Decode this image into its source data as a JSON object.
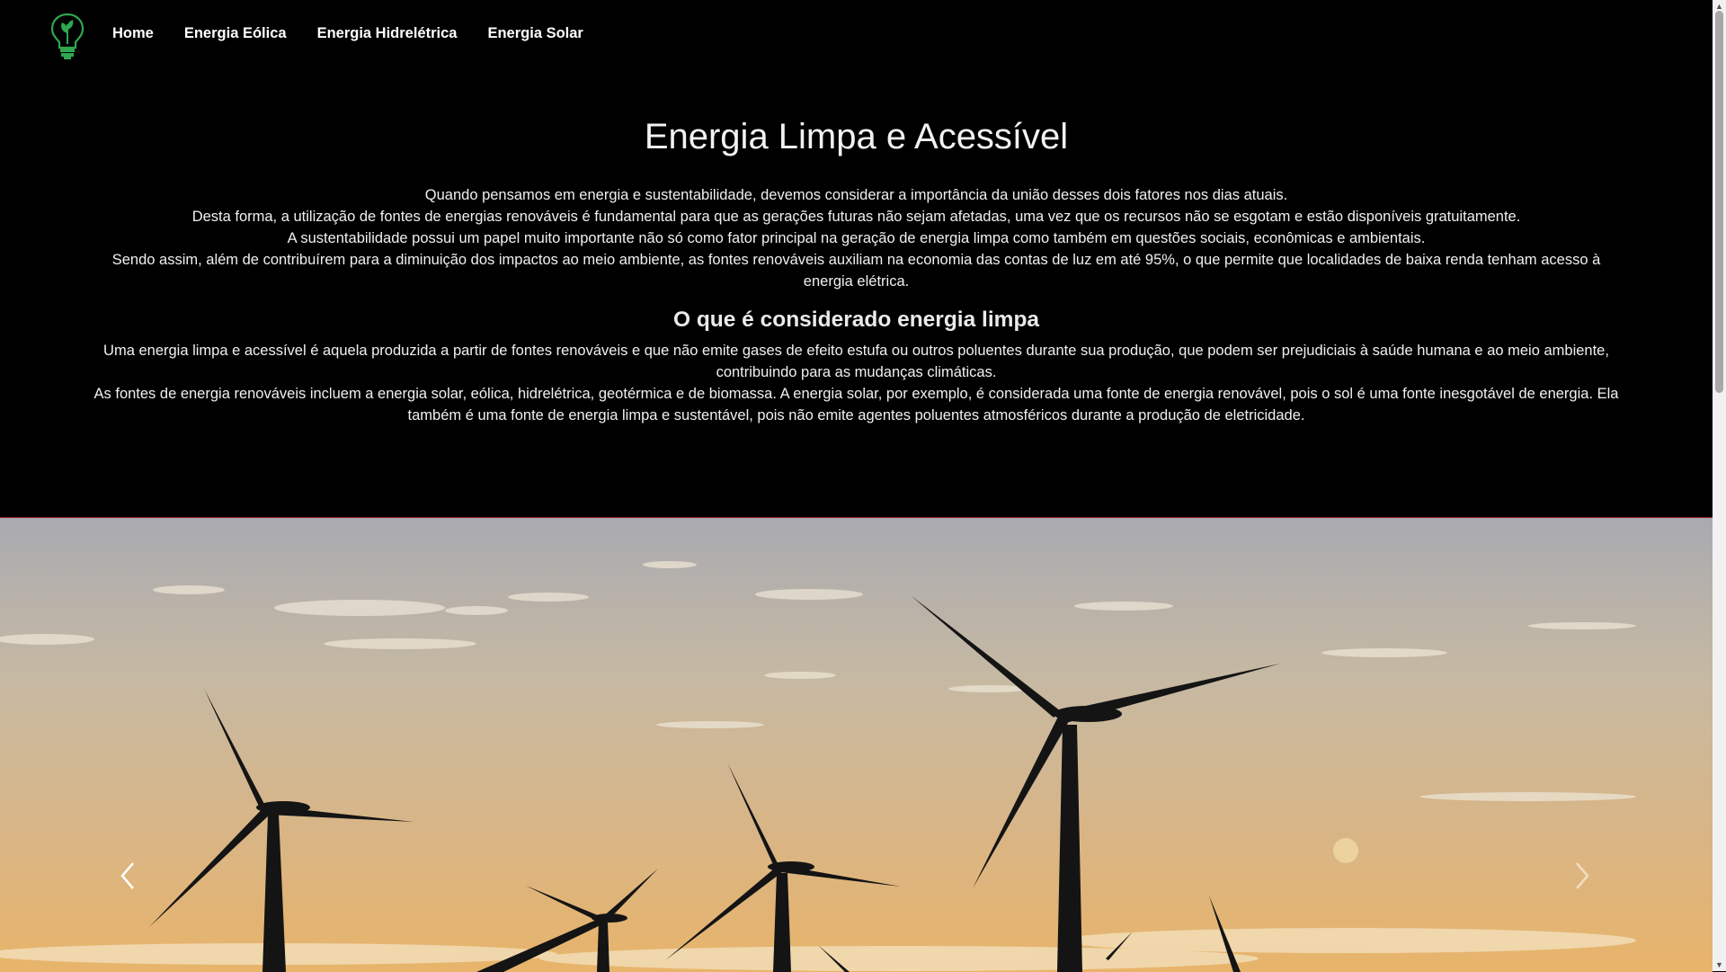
{
  "nav": {
    "logo_icon": "lightbulb-leaf-icon",
    "links": [
      "Home",
      "Energia Eólica",
      "Energia Hidrelétrica",
      "Energia Solar"
    ]
  },
  "intro": {
    "title": "Energia Limpa e Acessível",
    "paragraphs": [
      "Quando pensamos em energia e sustentabilidade, devemos considerar a importância da união desses dois fatores nos dias atuais.",
      "Desta forma, a utilização de fontes de energias renováveis é fundamental para que as gerações futuras não sejam afetadas, uma vez que os recursos não se esgotam e estão disponíveis gratuitamente.",
      "A sustentabilidade possui um papel muito importante não só como fator principal na geração de energia limpa como também em questões sociais, econômicas e ambientais.",
      "Sendo assim, além de contribuírem para a diminuição dos impactos ao meio ambiente, as fontes renováveis auxiliam na economia das contas de luz em até 95%, o que permite que localidades de baixa renda tenham acesso à energia elétrica."
    ],
    "subtitle": "O que é considerado energia limpa",
    "subparagraphs": [
      "Uma energia limpa e acessível é aquela produzida a partir de fontes renováveis e que não emite gases de efeito estufa ou outros poluentes durante sua produção, que podem ser prejudiciais à saúde humana e ao meio ambiente, contribuindo para as mudanças climáticas.",
      "As fontes de energia renováveis incluem a energia solar, eólica, hidrelétrica, geotérmica e de biomassa. A energia solar, por exemplo, é considerada uma fonte de energia renovável, pois o sol é uma fonte inesgotável de energia. Ela também é uma fonte de energia limpa e sustentável, pois não emite agentes poluentes atmosféricos durante a produção de eletricidade."
    ]
  },
  "carousel": {
    "slide_image": "wind-turbines-sunset-image",
    "prev_icon": "chevron-left-icon",
    "next_icon": "chevron-right-icon"
  },
  "colors": {
    "background": "#000000",
    "logo_green": "#2fa84f",
    "carousel_border": "#8b1a1a"
  }
}
